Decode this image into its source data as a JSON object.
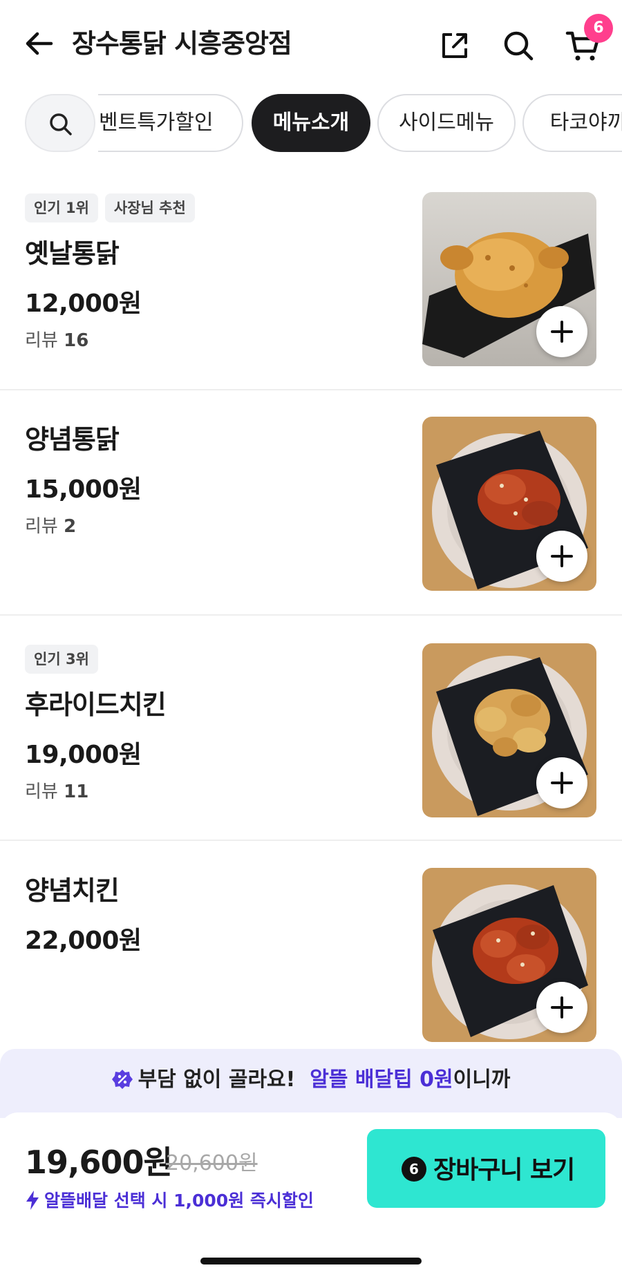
{
  "header": {
    "title": "장수통닭 시흥중앙점",
    "cart_count": "6"
  },
  "categories": [
    {
      "label": "이벤트특가할인",
      "active": false
    },
    {
      "label": "메뉴소개",
      "active": true
    },
    {
      "label": "사이드메뉴",
      "active": false
    },
    {
      "label": "타코야끼",
      "active": false
    }
  ],
  "menu": [
    {
      "tags": [
        "인기 1위",
        "사장님 추천"
      ],
      "name": "옛날통닭",
      "price": "12,000원",
      "review_label": "리뷰",
      "review_count": "16",
      "image": "fried-whole-chicken"
    },
    {
      "tags": [],
      "name": "양념통닭",
      "price": "15,000원",
      "review_label": "리뷰",
      "review_count": "2",
      "image": "seasoned-chicken"
    },
    {
      "tags": [
        "인기 3위"
      ],
      "name": "후라이드치킨",
      "price": "19,000원",
      "review_label": "리뷰",
      "review_count": "11",
      "image": "fried-chicken"
    },
    {
      "tags": [],
      "name": "양념치킨",
      "price": "22,000원",
      "review_label": "",
      "review_count": "",
      "image": "seasoned-chicken"
    }
  ],
  "promo": {
    "text_plain": "부담 없이 골라요!",
    "text_accent": "알뜰 배달팁 0원",
    "text_suffix": "이니까",
    "icon": "discount-badge-icon"
  },
  "checkout": {
    "total_price": "19,600원",
    "original_price": "20,600원",
    "discount_note": "알뜰배달 선택 시 1,000원 즉시할인",
    "cta_badge": "6",
    "cta_label": "장바구니 보기",
    "cta_color": "#2ee6d1",
    "accent_color": "#4b2fd6",
    "badge_color": "#ff3f8d"
  }
}
